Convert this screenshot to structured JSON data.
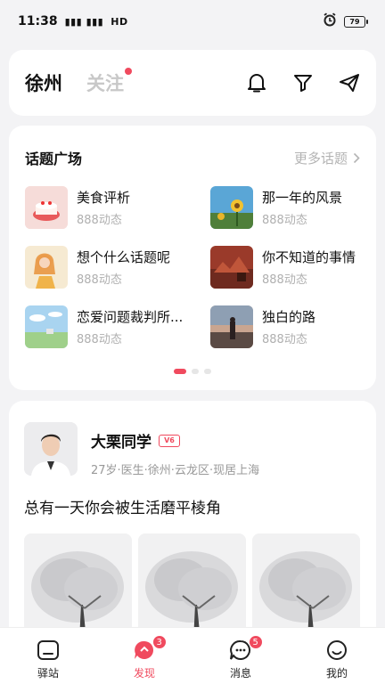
{
  "status_bar": {
    "time": "11:38",
    "network": "HD",
    "battery": "79"
  },
  "header": {
    "tabs": [
      {
        "label": "徐州"
      },
      {
        "label": "关注"
      }
    ]
  },
  "topics": {
    "title": "话题广场",
    "more_label": "更多话题",
    "items": [
      {
        "name": "美食评析",
        "count": "888动态"
      },
      {
        "name": "那一年的风景",
        "count": "888动态"
      },
      {
        "name": "想个什么话题呢",
        "count": "888动态"
      },
      {
        "name": "你不知道的事情",
        "count": "888动态"
      },
      {
        "name": "恋爱问题裁判所...",
        "count": "888动态"
      },
      {
        "name": "独白的路",
        "count": "888动态"
      }
    ]
  },
  "post": {
    "author_name": "大栗同学",
    "vip_badge": "V6",
    "meta": "27岁·医生·徐州·云龙区·现居上海",
    "text": "总有一天你会被生活磨平棱角"
  },
  "bottom_nav": {
    "items": [
      {
        "label": "驿站"
      },
      {
        "label": "发现",
        "badge": "3"
      },
      {
        "label": "消息",
        "badge": "5"
      },
      {
        "label": "我的"
      }
    ]
  },
  "colors": {
    "accent": "#f04a5e",
    "background": "#f3f3f5"
  }
}
